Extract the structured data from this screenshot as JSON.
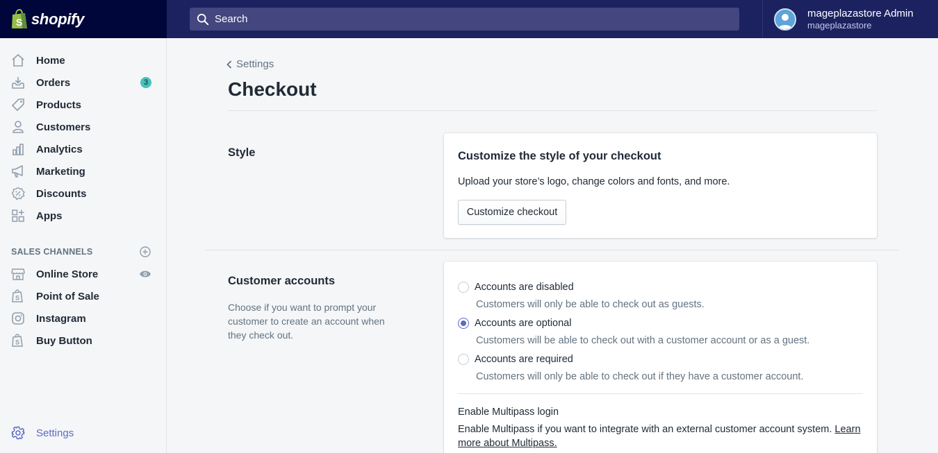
{
  "brand": {
    "name": "shopify"
  },
  "search": {
    "placeholder": "Search"
  },
  "account": {
    "name": "mageplazastore Admin",
    "store": "mageplazastore"
  },
  "sidebar": {
    "items": [
      {
        "label": "Home",
        "icon": "home-icon"
      },
      {
        "label": "Orders",
        "icon": "orders-icon",
        "badge": "3"
      },
      {
        "label": "Products",
        "icon": "tag-icon"
      },
      {
        "label": "Customers",
        "icon": "person-icon"
      },
      {
        "label": "Analytics",
        "icon": "bar-chart-icon"
      },
      {
        "label": "Marketing",
        "icon": "megaphone-icon"
      },
      {
        "label": "Discounts",
        "icon": "discount-icon"
      },
      {
        "label": "Apps",
        "icon": "apps-icon"
      }
    ],
    "sales_channels_title": "SALES CHANNELS",
    "channels": [
      {
        "label": "Online Store",
        "icon": "store-icon"
      },
      {
        "label": "Point of Sale",
        "icon": "shopify-bag-icon"
      },
      {
        "label": "Instagram",
        "icon": "instagram-icon"
      },
      {
        "label": "Buy Button",
        "icon": "shopify-bag-icon"
      }
    ],
    "settings_label": "Settings"
  },
  "page": {
    "breadcrumb": "Settings",
    "title": "Checkout"
  },
  "style_section": {
    "title": "Style",
    "card_title": "Customize the style of your checkout",
    "card_text": "Upload your store’s logo, change colors and fonts, and more.",
    "button_label": "Customize checkout"
  },
  "accounts_section": {
    "title": "Customer accounts",
    "description": "Choose if you want to prompt your customer to create an account when they check out.",
    "options": [
      {
        "label": "Accounts are disabled",
        "help": "Customers will only be able to check out as guests.",
        "selected": false
      },
      {
        "label": "Accounts are optional",
        "help": "Customers will be able to check out with a customer account or as a guest.",
        "selected": true
      },
      {
        "label": "Accounts are required",
        "help": "Customers will only be able to check out if they have a customer account.",
        "selected": false
      }
    ],
    "multipass_title": "Enable Multipass login",
    "multipass_text": "Enable Multipass if you want to integrate with an external customer account system.",
    "multipass_link": "Learn more about Multipass."
  },
  "colors": {
    "topbar": "#1c2260",
    "brand_bg": "#000639",
    "accent": "#5c6ac4",
    "badge": "#47c1bf"
  }
}
